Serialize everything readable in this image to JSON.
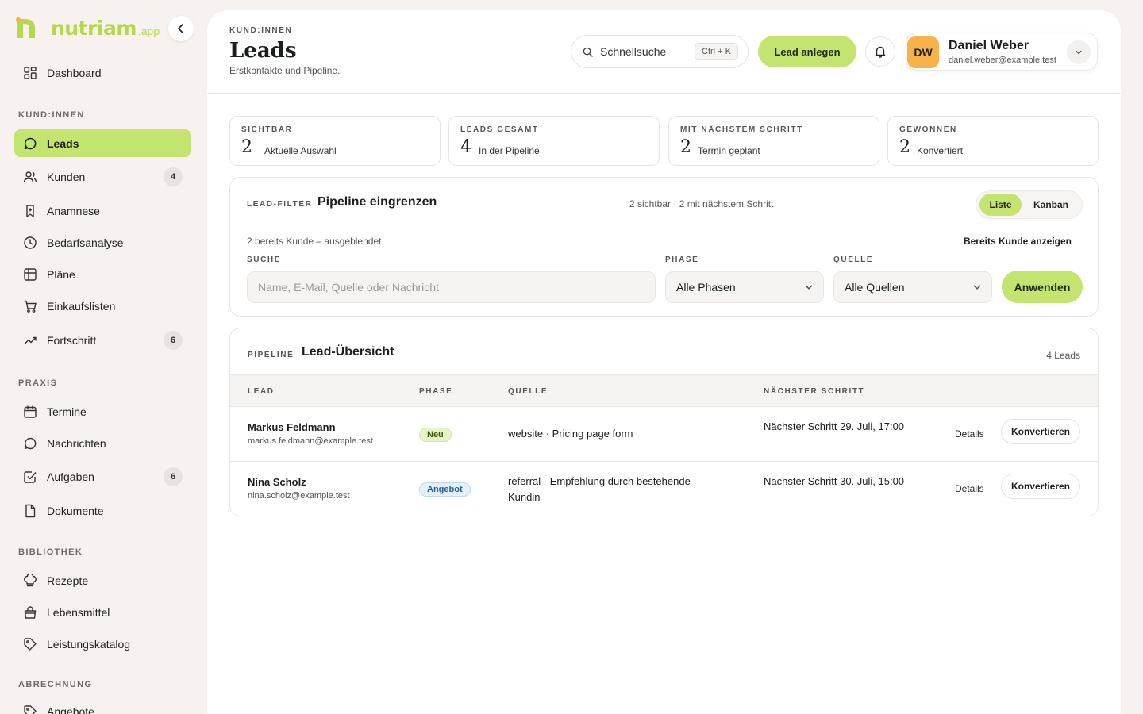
{
  "brand": {
    "name": "nutriam",
    "suffix": ".app"
  },
  "sidebar": {
    "dashboard": "Dashboard",
    "sections": {
      "customers": "KUND:INNEN",
      "practice": "PRAXIS",
      "library": "BIBLIOTHEK",
      "billing": "ABRECHNUNG"
    },
    "items": {
      "leads": {
        "label": "Leads"
      },
      "kunden": {
        "label": "Kunden",
        "badge": "4"
      },
      "anamnese": {
        "label": "Anamnese"
      },
      "bedarfsanalyse": {
        "label": "Bedarfsanalyse"
      },
      "plaene": {
        "label": "Pläne"
      },
      "einkaufslisten": {
        "label": "Einkaufslisten"
      },
      "fortschritt": {
        "label": "Fortschritt",
        "badge": "6"
      },
      "termine": {
        "label": "Termine"
      },
      "nachrichten": {
        "label": "Nachrichten"
      },
      "aufgaben": {
        "label": "Aufgaben",
        "badge": "6"
      },
      "dokumente": {
        "label": "Dokumente"
      },
      "rezepte": {
        "label": "Rezepte"
      },
      "lebensmittel": {
        "label": "Lebensmittel"
      },
      "leistungskatalog": {
        "label": "Leistungskatalog"
      },
      "angebote": {
        "label": "Angebote"
      }
    }
  },
  "header": {
    "eyebrow": "KUND:INNEN",
    "title": "Leads",
    "subtitle": "Erstkontakte und Pipeline.",
    "quicksearch_label": "Schnellsuche",
    "quicksearch_shortcut": "Ctrl + K",
    "create_lead": "Lead anlegen"
  },
  "user": {
    "initials": "DW",
    "name": "Daniel Weber",
    "email": "daniel.weber@example.test"
  },
  "stats": [
    {
      "label": "SICHTBAR",
      "value": "2",
      "caption": "Aktuelle Auswahl"
    },
    {
      "label": "LEADS GESAMT",
      "value": "4",
      "caption": "In der Pipeline"
    },
    {
      "label": "MIT NÄCHSTEM SCHRITT",
      "value": "2",
      "caption": "Termin geplant"
    },
    {
      "label": "GEWONNEN",
      "value": "2",
      "caption": "Konvertiert"
    }
  ],
  "filter": {
    "eyebrow": "LEAD-FILTER",
    "title": "Pipeline eingrenzen",
    "meta": "2 sichtbar · 2 mit nächstem Schritt",
    "view_list": "Liste",
    "view_kanban": "Kanban",
    "hidden_note": "2 bereits Kunde – ausgeblendet",
    "show_customers": "Bereits Kunde anzeigen",
    "search_label": "SUCHE",
    "search_placeholder": "Name, E-Mail, Quelle oder Nachricht",
    "phase_label": "PHASE",
    "phase_value": "Alle Phasen",
    "source_label": "QUELLE",
    "source_value": "Alle Quellen",
    "apply": "Anwenden"
  },
  "pipeline": {
    "eyebrow": "PIPELINE",
    "title": "Lead-Übersicht",
    "count": "4 Leads",
    "columns": {
      "lead": "LEAD",
      "phase": "PHASE",
      "source": "QUELLE",
      "next_step": "NÄCHSTER SCHRITT"
    },
    "rows": [
      {
        "name": "Markus Feldmann",
        "email": "markus.feldmann@example.test",
        "phase": "Neu",
        "source": "website · Pricing page form",
        "next_step": "Nächster Schritt 29. Juli, 17:00",
        "details": "Details",
        "convert": "Konvertieren"
      },
      {
        "name": "Nina Scholz",
        "email": "nina.scholz@example.test",
        "phase": "Angebot",
        "source": "referral · Empfehlung durch bestehende Kundin",
        "next_step": "Nächster Schritt 30. Juli, 15:00",
        "details": "Details",
        "convert": "Konvertieren"
      }
    ]
  },
  "colors": {
    "accent": "#c3e46e",
    "brand": "#b4d84a",
    "background": "#f7f2ef",
    "avatar": "#f7b24a"
  },
  "icons": {
    "dashboard": "grid-icon",
    "leads": "chat-bubble-icon",
    "kunden": "users-icon",
    "anamnese": "bookmark-icon",
    "bedarfsanalyse": "clock-icon",
    "plaene": "table-icon",
    "einkaufslisten": "cart-icon",
    "fortschritt": "trending-up-icon",
    "termine": "calendar-icon",
    "nachrichten": "chat-bubble-icon",
    "aufgaben": "checkbox-icon",
    "dokumente": "document-icon",
    "rezepte": "chef-hat-icon",
    "lebensmittel": "shopping-bag-icon",
    "leistungskatalog": "tag-icon",
    "angebote": "tag-icon"
  }
}
